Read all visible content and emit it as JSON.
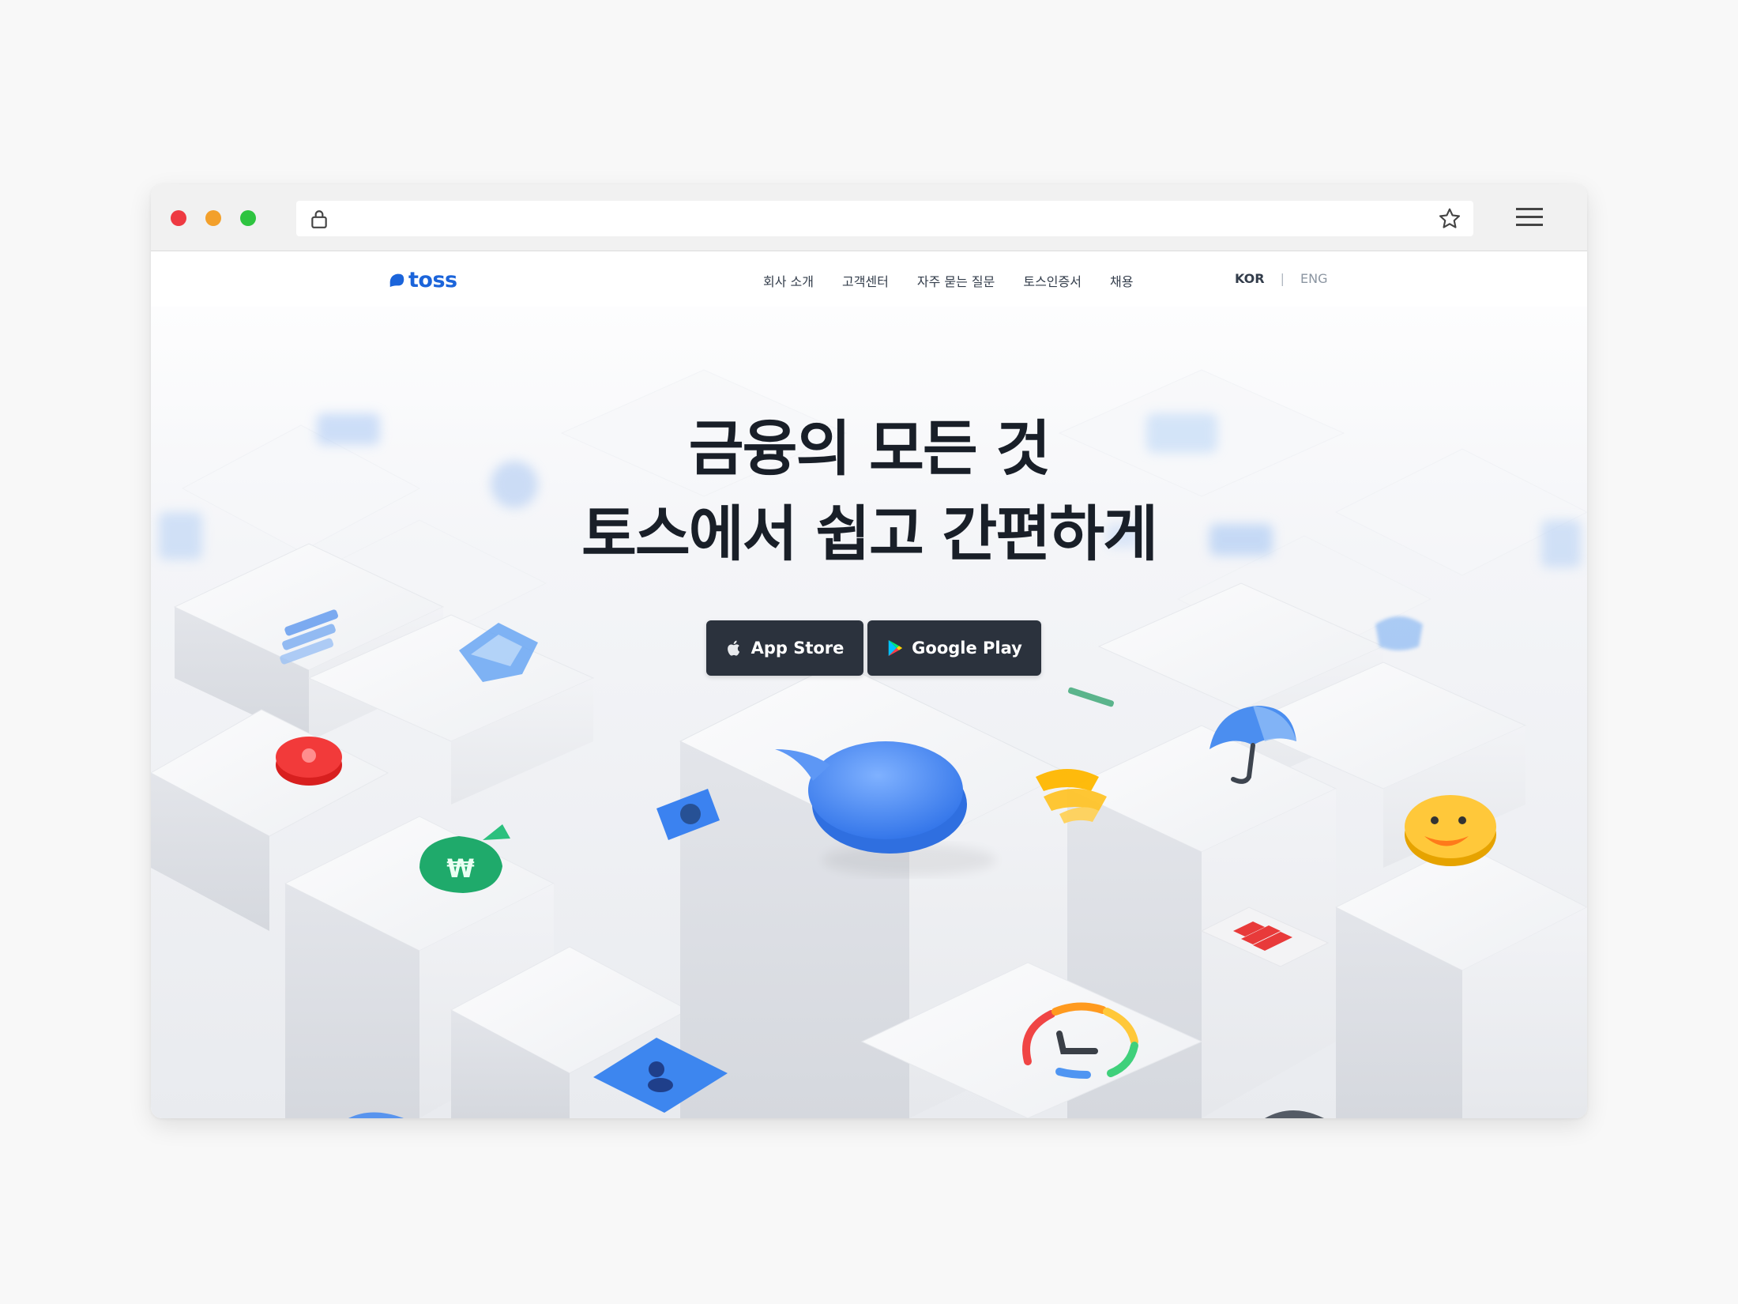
{
  "browser": {
    "controls": [
      "close",
      "minimize",
      "maximize"
    ],
    "address_icon": "lock-icon",
    "bookmark_icon": "star-icon",
    "menu_icon": "hamburger-menu-icon"
  },
  "nav": {
    "logo_text": "toss",
    "logo_icon": "toss-logo-icon",
    "links": [
      "회사 소개",
      "고객센터",
      "자주 묻는 질문",
      "토스인증서",
      "채용"
    ],
    "lang_kor": "KOR",
    "lang_sep": "|",
    "lang_eng": "ENG"
  },
  "hero": {
    "headline_line1": "금융의 모든 것",
    "headline_line2": "토스에서 쉽고 간편하게",
    "app_store_label": "App Store",
    "google_play_label": "Google Play"
  },
  "colors": {
    "brand": "#1b64da",
    "button_bg": "#2b323d",
    "headline": "#191f28"
  }
}
